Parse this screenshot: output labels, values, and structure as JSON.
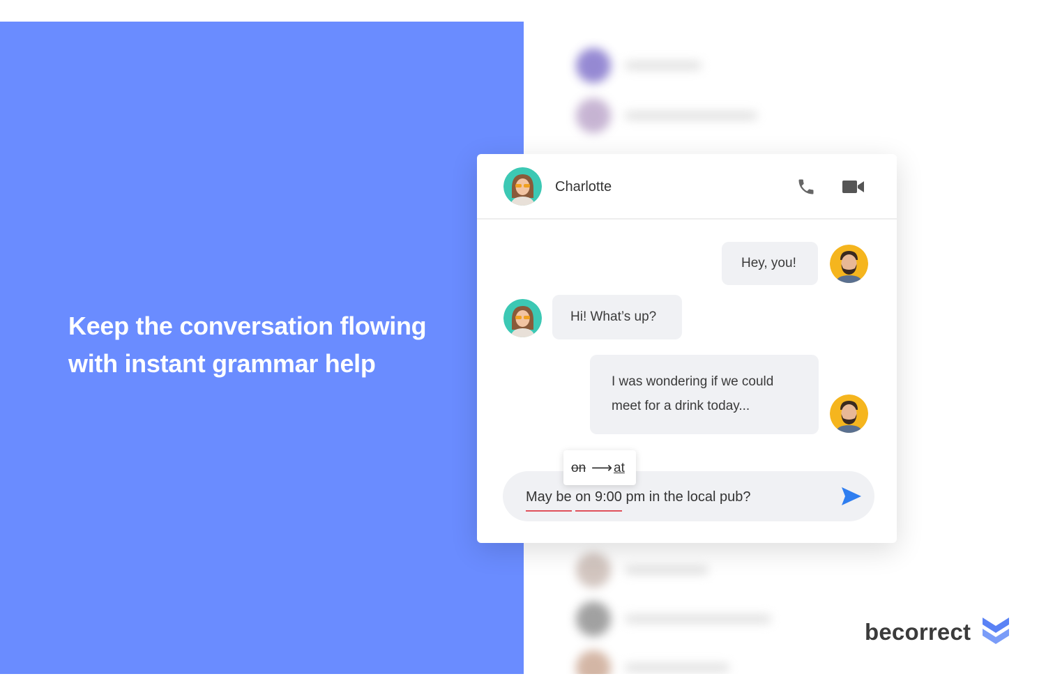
{
  "headline": {
    "line1": "Keep the conversation flowing",
    "line2": "with instant grammar help"
  },
  "chat": {
    "contact_name": "Charlotte",
    "header_icons": [
      "phone-icon",
      "video-camera-icon"
    ],
    "messages": [
      {
        "sender": "me",
        "lines": [
          "Hey, you!"
        ]
      },
      {
        "sender": "charlotte",
        "lines": [
          "Hi! What’s up?"
        ]
      },
      {
        "sender": "me",
        "lines": [
          "I was wondering if we could",
          "meet for a drink today..."
        ]
      }
    ],
    "suggestion": {
      "original": "on",
      "arrow": "⟶",
      "replacement": "at"
    },
    "input": {
      "seg1": "May be",
      "seg2": " ",
      "seg3": "on 9:00",
      "seg4": " pm in the local pub?"
    }
  },
  "brand": {
    "name": "becorrect",
    "accent": "#6a8cff",
    "send_color": "#2f7ef0",
    "error_underline": "#e0505a",
    "mark_color": "#5a82f5"
  }
}
